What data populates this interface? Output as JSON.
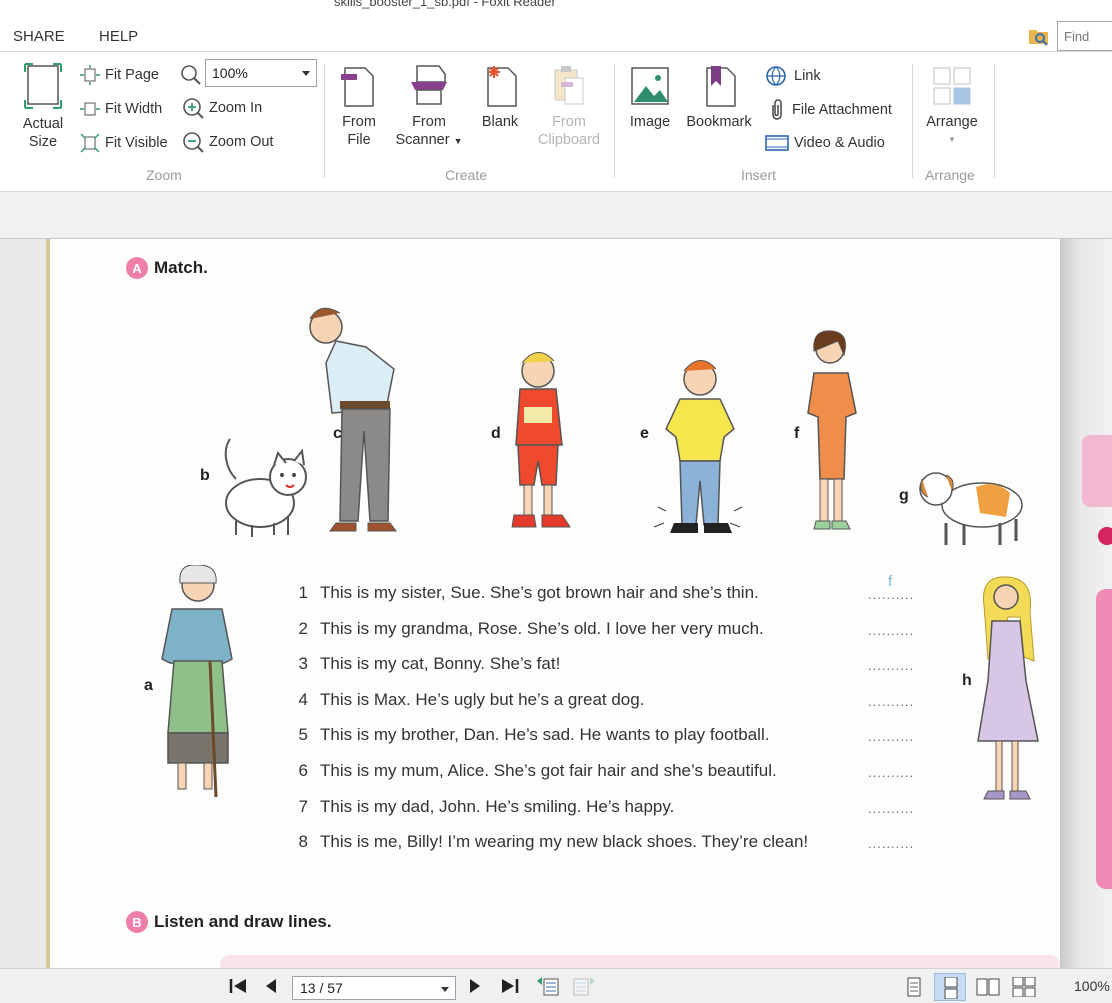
{
  "window": {
    "title": "skills_booster_1_sb.pdf - Foxit Reader"
  },
  "menu": {
    "items": [
      "SHARE",
      "HELP"
    ]
  },
  "find": {
    "placeholder": "Find"
  },
  "ribbon": {
    "zoom_group": {
      "label": "Zoom",
      "actual_size": [
        "Actual",
        "Size"
      ],
      "fit_page": "Fit Page",
      "fit_width": "Fit Width",
      "fit_visible": "Fit Visible",
      "zoom_value": "100%",
      "zoom_in": "Zoom In",
      "zoom_out": "Zoom Out"
    },
    "create_group": {
      "label": "Create",
      "from_file": [
        "From",
        "File"
      ],
      "from_scanner": [
        "From",
        "Scanner"
      ],
      "blank": "Blank",
      "from_clipboard": [
        "From",
        "Clipboard"
      ]
    },
    "insert_group": {
      "label": "Insert",
      "image": "Image",
      "bookmark": "Bookmark",
      "link": "Link",
      "file_attachment": "File Attachment",
      "video_audio": "Video & Audio"
    },
    "arrange_group": {
      "label": "Arrange",
      "arrange": "Arrange"
    }
  },
  "document": {
    "section_a": {
      "badge": "A",
      "title": "Match."
    },
    "section_b": {
      "badge": "B",
      "title": "Listen and draw lines."
    },
    "figure_letters": [
      "a",
      "b",
      "c",
      "d",
      "e",
      "f",
      "g",
      "h"
    ],
    "sentences": [
      {
        "num": "1",
        "text": "This is my sister, Sue. She’s got brown hair and she’s thin.",
        "blank": "..........",
        "answer": "f"
      },
      {
        "num": "2",
        "text": "This is my grandma, Rose. She’s old. I love her very much.",
        "blank": ".........."
      },
      {
        "num": "3",
        "text": "This is my cat, Bonny. She’s fat!",
        "blank": ".........."
      },
      {
        "num": "4",
        "text": "This is Max. He’s ugly but he’s a great dog.",
        "blank": ".........."
      },
      {
        "num": "5",
        "text": "This is my brother, Dan. He’s sad. He wants to play football.",
        "blank": ".........."
      },
      {
        "num": "6",
        "text": "This is my mum, Alice. She’s got fair hair and she’s beautiful.",
        "blank": ".........."
      },
      {
        "num": "7",
        "text": "This is my dad, John. He’s smiling. He’s happy.",
        "blank": ".........."
      },
      {
        "num": "8",
        "text": "This is me, Billy! I’m wearing my new black shoes. They’re clean!",
        "blank": ".........."
      }
    ]
  },
  "statusbar": {
    "page": "13 / 57",
    "zoom": "100%"
  },
  "colors": {
    "badge_pink": "#ef7fa8",
    "page_border": "#d7c69a",
    "answer_blue": "#7bb5d9"
  }
}
